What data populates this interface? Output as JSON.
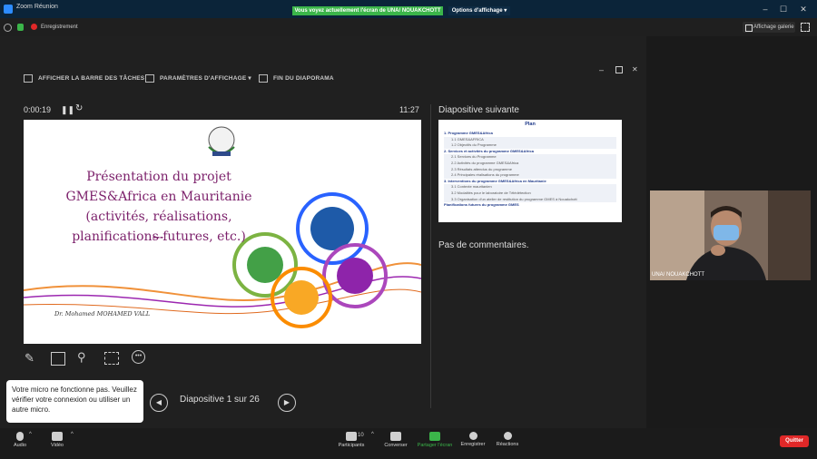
{
  "window": {
    "title": "Zoom Réunion",
    "share_banner": "Vous voyez actuellement l'écran de UNA/ NOUAKCHOTT",
    "share_options": "Options d'affichage",
    "controls": [
      "–",
      "☐",
      "✕"
    ]
  },
  "topstrip": {
    "recording_label": "Enregistrement",
    "gallery_label": "Affichage galerie"
  },
  "presenter_view": {
    "buttons": [
      "AFFICHER LA BARRE DES TÂCHES",
      "PARAMÈTRES D'AFFICHAGE ▾",
      "FIN DU DIAPORAMA"
    ],
    "elapsed_time": "0:00:19",
    "clock": "11:27",
    "next_slide_label": "Diapositive suivante",
    "notes": "Pas de commentaires.",
    "slide_counter": "Diapositive 1 sur 26"
  },
  "slide": {
    "title": "Présentation du projet GMES&Africa en Mauritanie (activités, réalisations, planifications futures, etc.)",
    "dashes": "---",
    "author": "Dr. Mohamed MOHAMED VALL",
    "logo_text": "U.N.A"
  },
  "next_slide": {
    "heading": "Plan",
    "items": [
      "1. Programme GMES&Africa",
      "1.1 GMES&AFRICA",
      "1.2 Objectifs du Programme",
      "2. Services et activités du programme GMES&Africa",
      "2.1 Services du Programme",
      "2.2 Activités du programme GMES&Africa",
      "2.3 Résultats attendus du programme",
      "2.4 Principales réalisations du programme",
      "3. Interventions du programme GMES&Africa en Mauritanie",
      "3.1 Contexte mauritanien",
      "3.2 Modalités pour le laboratoire de Télédétection",
      "3.3 Organisation d'un atelier de restitution du programme GMES à Nouakchott",
      "Planifications futures du programme GMES"
    ]
  },
  "video": {
    "participant_name": "UNA/ NOUAKCHOTT"
  },
  "toast": {
    "message": "Votre micro ne fonctionne pas. Veuillez vérifier votre connexion ou utiliser un autre micro."
  },
  "bottombar": {
    "audio": "Audio",
    "video": "Vidéo",
    "participants": "Participants",
    "participants_count": "10",
    "chat": "Converser",
    "share": "Partager l'écran",
    "record": "Enregistrer",
    "reactions": "Réactions",
    "quit": "Quitter"
  },
  "colors": {
    "share_green": "#3bb54a",
    "quit_red": "#e02828",
    "slide_title_purple": "#7b1f6a"
  }
}
